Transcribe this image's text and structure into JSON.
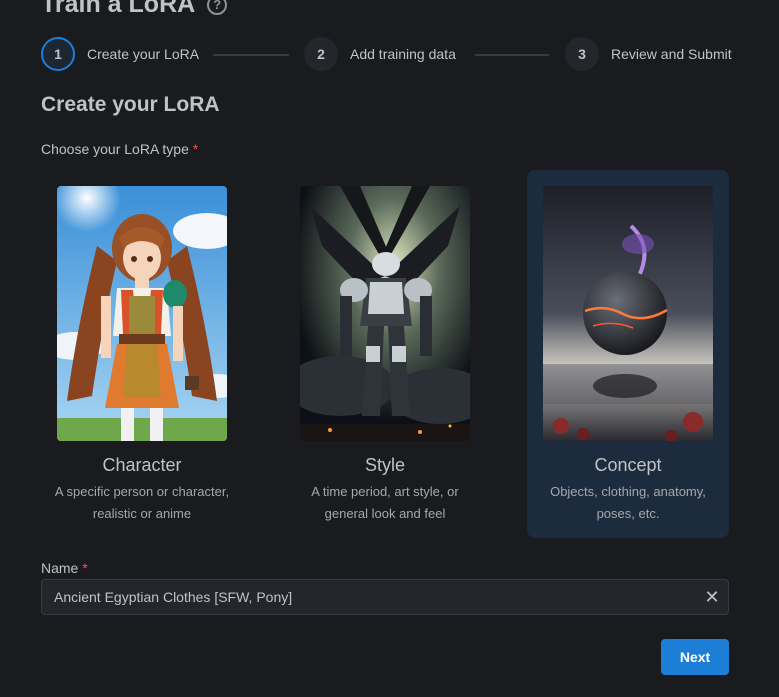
{
  "page": {
    "title": "Train a LoRA",
    "help_icon": "question-circle-icon",
    "help_glyph": "?"
  },
  "stepper": {
    "steps": [
      {
        "number": "1",
        "label": "Create your LoRA",
        "active": true
      },
      {
        "number": "2",
        "label": "Add training data",
        "active": false
      },
      {
        "number": "3",
        "label": "Review and Submit",
        "active": false
      }
    ]
  },
  "section": {
    "title": "Create your LoRA",
    "type_label": "Choose your LoRA type",
    "required_marker": "*"
  },
  "lora_types": [
    {
      "title": "Character",
      "description": "A specific person or character, realistic or anime",
      "selected": false
    },
    {
      "title": "Style",
      "description": "A time period, art style, or general look and feel",
      "selected": false
    },
    {
      "title": "Concept",
      "description": "Objects, clothing, anatomy, poses, etc.",
      "selected": true
    }
  ],
  "name_field": {
    "label": "Name",
    "required_marker": "*",
    "value": "Ancient Egyptian Clothes [SFW, Pony]",
    "clear_icon": "close-icon",
    "clear_glyph": "✕"
  },
  "actions": {
    "next_label": "Next"
  },
  "colors": {
    "background": "#1a1b1e",
    "accent": "#1c7ed6",
    "selected_card": "#1d2b3e",
    "required": "#fa5252"
  }
}
